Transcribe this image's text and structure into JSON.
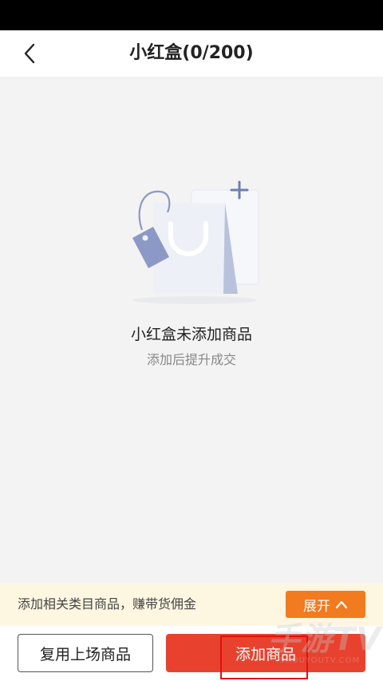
{
  "header": {
    "title": "小红盒(0/200)",
    "back_icon": "chevron-left-icon"
  },
  "empty_state": {
    "illustration_icon": "shopping-bag-tag-plus-icon",
    "title": "小红盒未添加商品",
    "subtitle": "添加后提升成交"
  },
  "promo": {
    "text": "添加相关类目商品，赚带货佣金",
    "expand_label": "展开",
    "expand_icon": "chevron-up-icon",
    "background_color": "#fdf6e1",
    "button_color": "#f27a1f"
  },
  "bottom": {
    "reuse_label": "复用上场商品",
    "add_label": "添加商品",
    "add_color": "#e8422f"
  },
  "watermark": {
    "main": "手游TV",
    "sub": "SHOUYOUTV.COM"
  }
}
